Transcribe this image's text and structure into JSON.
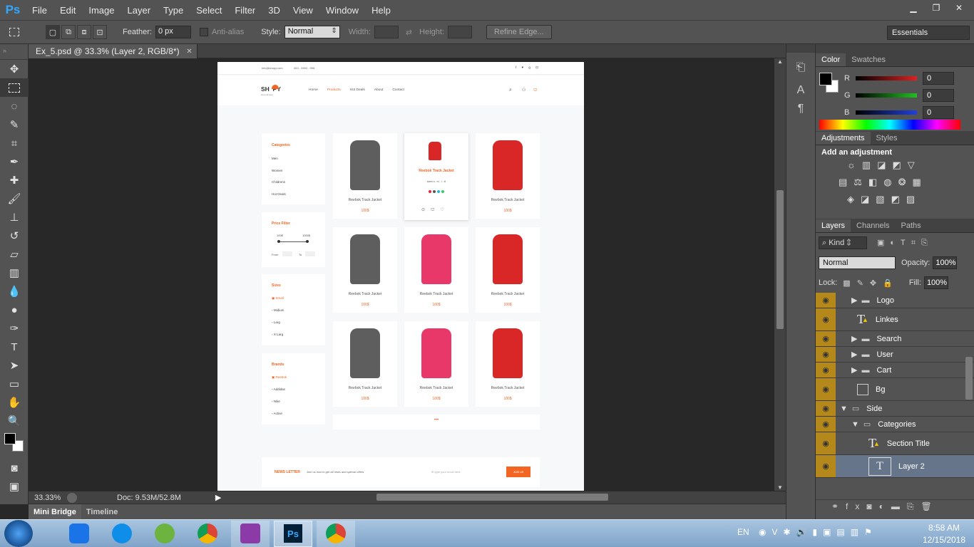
{
  "app": {
    "logo": "Ps"
  },
  "menu": [
    "File",
    "Edit",
    "Image",
    "Layer",
    "Type",
    "Select",
    "Filter",
    "3D",
    "View",
    "Window",
    "Help"
  ],
  "window_buttons": [
    "▁",
    "❐",
    "✕"
  ],
  "options": {
    "feather_label": "Feather:",
    "feather_value": "0 px",
    "antialias_label": "Anti-alias",
    "style_label": "Style:",
    "style_value": "Normal",
    "width_label": "Width:",
    "height_label": "Height:",
    "refine_edge": "Refine Edge...",
    "workspace": "Essentials"
  },
  "document": {
    "tab_title": "Ex_5.psd @ 33.3% (Layer 2, RGB/8*)",
    "close": "✕"
  },
  "status": {
    "zoom": "33.33%",
    "doc": "Doc: 9.53M/52.8M"
  },
  "mini_tabs": [
    "Mini Bridge",
    "Timeline"
  ],
  "color_panel": {
    "tabs": [
      "Color",
      "Swatches"
    ],
    "channels": [
      {
        "label": "R",
        "value": "0",
        "color": "#e02020"
      },
      {
        "label": "G",
        "value": "0",
        "color": "#20c020"
      },
      {
        "label": "B",
        "value": "0",
        "color": "#2040e0"
      }
    ]
  },
  "adjustments": {
    "tabs": [
      "Adjustments",
      "Styles"
    ],
    "title": "Add an adjustment"
  },
  "layers_panel": {
    "tabs": [
      "Layers",
      "Channels",
      "Paths"
    ],
    "kind": "Kind",
    "blend": "Normal",
    "opacity_label": "Opacity:",
    "opacity": "100%",
    "lock_label": "Lock:",
    "fill_label": "Fill:",
    "fill": "100%",
    "layers": [
      {
        "name": "Logo",
        "type": "folder",
        "indent": 1
      },
      {
        "name": "Linkes",
        "type": "text-warn",
        "indent": 1
      },
      {
        "name": "Search",
        "type": "folder",
        "indent": 1
      },
      {
        "name": "User",
        "type": "folder",
        "indent": 1
      },
      {
        "name": "Cart",
        "type": "folder",
        "indent": 1
      },
      {
        "name": "Bg",
        "type": "shape",
        "indent": 1
      },
      {
        "name": "Side",
        "type": "folder-open",
        "indent": 0
      },
      {
        "name": "Categories",
        "type": "folder-open",
        "indent": 1
      },
      {
        "name": "Section Title",
        "type": "text-warn",
        "indent": 2
      },
      {
        "name": "Layer 2",
        "type": "text",
        "indent": 2,
        "selected": true
      }
    ]
  },
  "taskbar": {
    "lang": "EN",
    "time": "8:58 AM",
    "date": "12/15/2018"
  },
  "site": {
    "email": "info@shopy.com",
    "phone": "453 - 5553 - 996",
    "logo": "SH  PY",
    "logo_tag": "shop all here",
    "nav": [
      "Home",
      "Products",
      "Hot Deals",
      "About",
      "Contact"
    ],
    "nav_active": 1,
    "categories_title": "Categories",
    "categories": [
      "Men",
      "Women",
      "Childrens",
      "Hot Deals"
    ],
    "price_title": "Price Filter",
    "price_min": "100$",
    "price_max": "1000$",
    "price_from": "From",
    "price_to": "To",
    "sizes_title": "Sizes",
    "sizes": [
      "Small",
      "Midium",
      "Larg",
      "X Larg"
    ],
    "brands_title": "Brands",
    "brands": [
      "Reebok",
      "Addidas",
      "Nike",
      "Active"
    ],
    "product_name": "Reebok Track Jacket",
    "product_price": "100$",
    "hover_sizes": "sizes      s  -  m  -  l  -  xl",
    "more": "•••",
    "newsletter_title": "NEWS LETTER",
    "newsletter_text": "Join us now to get all news and special offers",
    "newsletter_placeholder": "type your email here",
    "newsletter_btn": "Join us"
  }
}
